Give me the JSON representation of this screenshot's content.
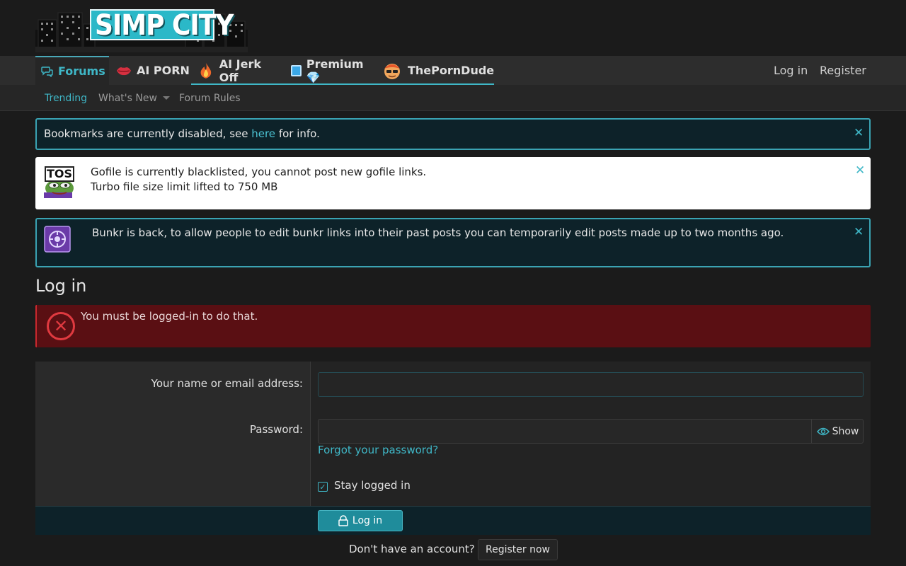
{
  "site": {
    "logo_text": "SIMP CITY"
  },
  "nav": {
    "tabs": [
      {
        "label": "Forums",
        "icon": "chat-bubbles-icon"
      },
      {
        "label": "AI PORN",
        "icon": "lips-icon"
      },
      {
        "label": "AI Jerk Off",
        "icon": "fire-icon"
      },
      {
        "label": "Premium 💎",
        "icon": "premium-icon"
      },
      {
        "label": "ThePornDude",
        "icon": "porndude-mascot-icon"
      }
    ],
    "login": "Log in",
    "register": "Register"
  },
  "subnav": {
    "trending": "Trending",
    "whats_new": "What's New",
    "forum_rules": "Forum Rules"
  },
  "notices": {
    "bookmarks": {
      "before": "Bookmarks are currently disabled, see ",
      "link": "here",
      "after": " for info."
    },
    "gofile": {
      "line1": "Gofile is currently blacklisted, you cannot post new gofile links.",
      "line2": "Turbo file size limit lifted to 750 MB",
      "badge": "TOS"
    },
    "bunkr": {
      "text": "Bunkr is back, to allow people to edit bunkr links into their past posts you can temporarily edit posts made up to two months ago."
    },
    "close": "✕"
  },
  "page": {
    "title": "Log in"
  },
  "error": {
    "text": "You must be logged-in to do that.",
    "icon": "✕"
  },
  "form": {
    "name_label": "Your name or email address:",
    "name_value": "",
    "password_label": "Password:",
    "password_value": "",
    "show_label": "Show",
    "forgot": "Forgot your password?",
    "stay_logged_in": "Stay logged in",
    "check_mark": "✓",
    "submit": "Log in"
  },
  "footer": {
    "no_account": "Don't have an account?",
    "register_now": "Register now"
  },
  "colors": {
    "accent": "#3fb7c7",
    "error_bg": "#5a0f13",
    "notice_bg": "#0d2229"
  }
}
